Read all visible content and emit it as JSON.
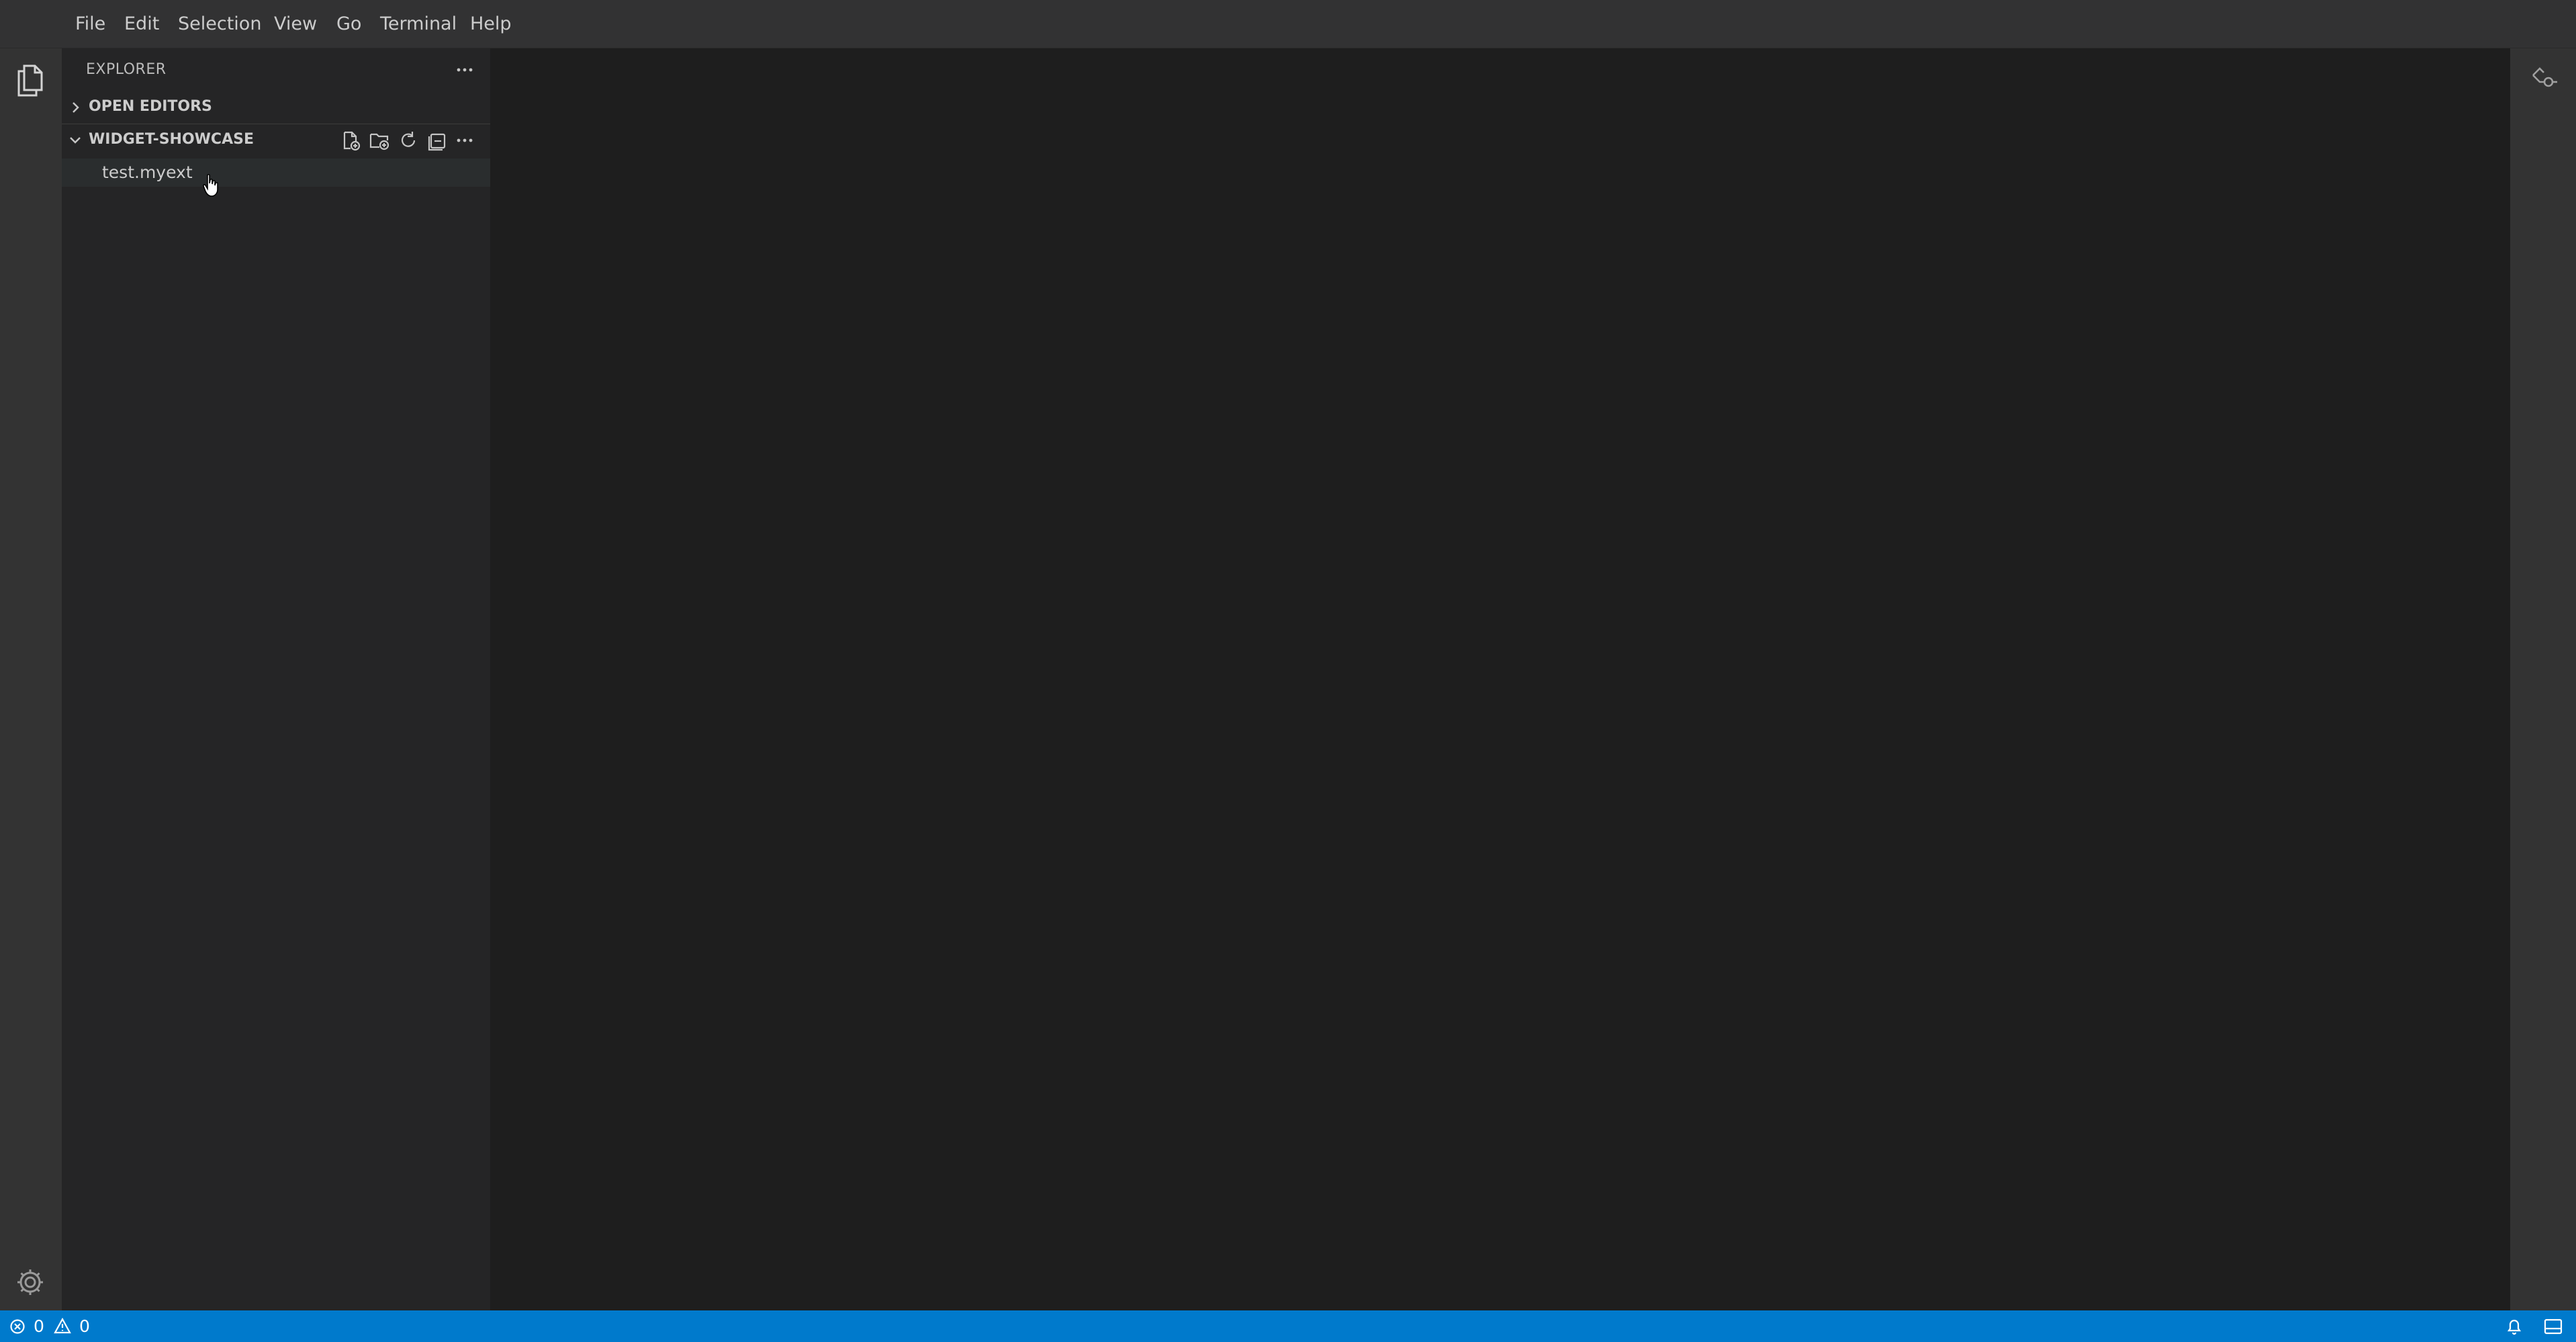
{
  "menu": [
    "File",
    "Edit",
    "Selection",
    "View",
    "Go",
    "Terminal",
    "Help"
  ],
  "explorer": {
    "title": "EXPLORER",
    "open_editors": "OPEN EDITORS",
    "folder": "WIDGET-SHOWCASE",
    "files": [
      "test.myext"
    ]
  },
  "status": {
    "errors": "0",
    "warnings": "0"
  },
  "colors": {
    "accent": "#007acc",
    "titlebar": "#323233",
    "activitybar": "#333333",
    "sidebar": "#252526",
    "editor": "#1e1e1e",
    "selected_row": "#37373d"
  },
  "icons": {
    "activity": [
      "files-icon",
      "settings-gear-icon"
    ],
    "folder_actions": [
      "new-file-icon",
      "new-folder-icon",
      "refresh-icon",
      "collapse-all-icon",
      "more-actions-icon"
    ],
    "rightbar": [
      "source-control-icon"
    ],
    "status": [
      "error-icon",
      "warning-icon",
      "bell-icon",
      "layout-icon"
    ]
  }
}
